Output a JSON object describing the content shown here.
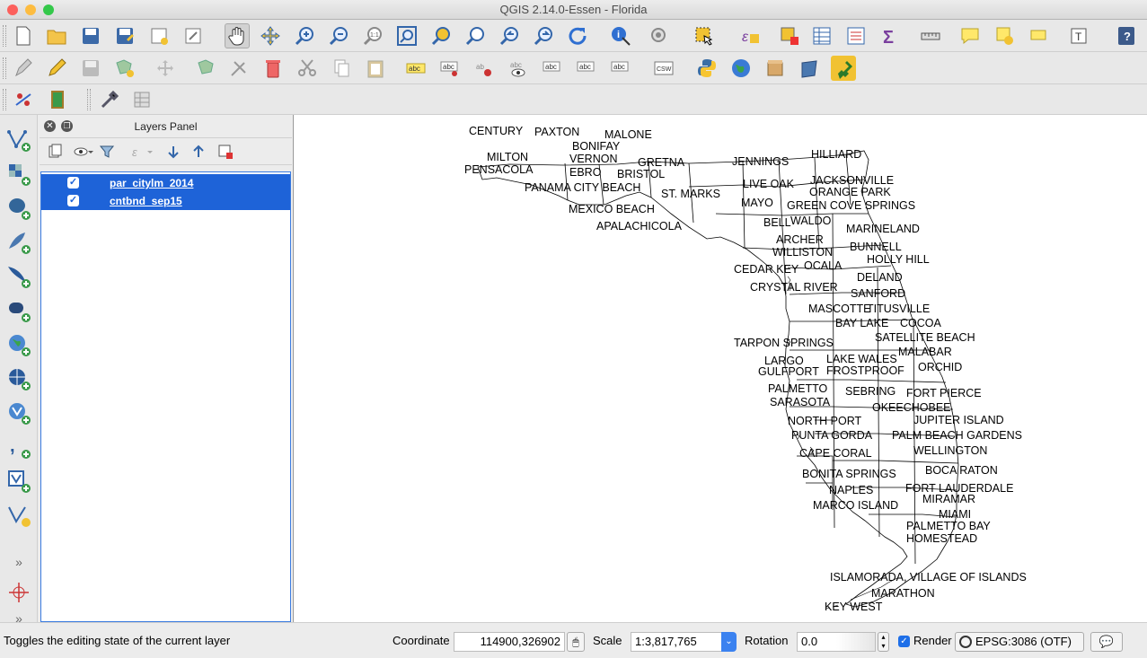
{
  "window": {
    "title": "QGIS 2.14.0-Essen - Florida"
  },
  "toolbar1": [
    "new-project-icon",
    "open-project-icon",
    "save-project-icon",
    "save-as-icon",
    "new-print-composer-icon",
    "composer-manager-icon",
    "pan-icon",
    "pan-to-selection-icon",
    "zoom-in-icon",
    "zoom-out-icon",
    "zoom-actual-icon",
    "zoom-full-icon",
    "zoom-to-selection-icon",
    "zoom-to-layer-icon",
    "zoom-last-icon",
    "zoom-next-icon",
    "refresh-icon",
    "identify-icon",
    "run-action-icon",
    "select-features-icon",
    "select-by-expression-icon",
    "deselect-icon",
    "attribute-table-icon",
    "field-calculator-icon",
    "statistical-summary-icon",
    "measure-icon",
    "map-tips-icon",
    "new-bookmark-icon",
    "show-bookmarks-icon",
    "text-annotation-icon",
    "help-icon"
  ],
  "toolbar2": [
    "current-edits-icon",
    "toggle-editing-icon",
    "save-edits-icon",
    "add-feature-icon",
    "move-feature-icon",
    "node-tool-icon",
    "delete-selected-icon",
    "cut-features-icon",
    "copy-features-icon",
    "paste-features-icon",
    "label-toolbar-icon",
    "pin-labels-icon",
    "highlight-pinned-icon",
    "show-hide-labels-icon",
    "move-label-icon",
    "rotate-label-icon",
    "change-label-icon",
    "csw-icon",
    "python-console-icon",
    "globe-icon",
    "db-manager-icon",
    "georeferencer-icon",
    "plugin-icon"
  ],
  "toolbar3": [
    "gps-icon",
    "layer-icon",
    "wrench-icon",
    "table-icon"
  ],
  "left_toolbar": [
    "add-vector-layer-icon",
    "add-raster-layer-icon",
    "add-postgis-layer-icon",
    "add-spatialite-layer-icon",
    "add-mssql-layer-icon",
    "add-oracle-layer-icon",
    "add-wms-layer-icon",
    "add-wcs-layer-icon",
    "add-wfs-layer-icon",
    "add-delimited-text-icon",
    "add-virtual-layer-icon",
    "new-shapefile-icon",
    "more-icon",
    "capture-point-icon",
    "more-bottom-icon"
  ],
  "layers_panel": {
    "title": "Layers Panel",
    "layers": [
      {
        "name": "par_citylm_2014",
        "checked": true
      },
      {
        "name": "cntbnd_sep15",
        "checked": true
      }
    ]
  },
  "map": {
    "labels": [
      {
        "text": "CENTURY"
      },
      {
        "text": "PAXTON"
      },
      {
        "text": "MALONE"
      },
      {
        "text": "BONIFAY"
      },
      {
        "text": "MILTON"
      },
      {
        "text": "VERNON"
      },
      {
        "text": "GRETNA"
      },
      {
        "text": "PENSACOLA"
      },
      {
        "text": "EBRO"
      },
      {
        "text": "BRISTOL"
      },
      {
        "text": "JENNINGS"
      },
      {
        "text": "HILLIARD"
      },
      {
        "text": "PANAMA CITY BEACH"
      },
      {
        "text": "ST. MARKS"
      },
      {
        "text": "LIVE OAK"
      },
      {
        "text": "JACKSONVILLE"
      },
      {
        "text": "ORANGE PARK"
      },
      {
        "text": "MAYO"
      },
      {
        "text": "GREEN COVE SPRINGS"
      },
      {
        "text": "MEXICO BEACH"
      },
      {
        "text": "APALACHICOLA"
      },
      {
        "text": "BELL"
      },
      {
        "text": "WALDO"
      },
      {
        "text": "MARINELAND"
      },
      {
        "text": "ARCHER"
      },
      {
        "text": "BUNNELL"
      },
      {
        "text": "WILLISTON"
      },
      {
        "text": "HOLLY HILL"
      },
      {
        "text": "CEDAR KEY"
      },
      {
        "text": "OCALA"
      },
      {
        "text": "DELAND"
      },
      {
        "text": "CRYSTAL RIVER"
      },
      {
        "text": "SANFORD"
      },
      {
        "text": "MASCOTTE"
      },
      {
        "text": "TITUSVILLE"
      },
      {
        "text": "BAY LAKE"
      },
      {
        "text": "COCOA"
      },
      {
        "text": "SATELLITE BEACH"
      },
      {
        "text": "TARPON SPRINGS"
      },
      {
        "text": "MALABAR"
      },
      {
        "text": "LARGO"
      },
      {
        "text": "LAKE WALES"
      },
      {
        "text": "ORCHID"
      },
      {
        "text": "GULFPORT"
      },
      {
        "text": "FROSTPROOF"
      },
      {
        "text": "PALMETTO"
      },
      {
        "text": "SEBRING"
      },
      {
        "text": "FORT PIERCE"
      },
      {
        "text": "SARASOTA"
      },
      {
        "text": "OKEECHOBEE"
      },
      {
        "text": "NORTH PORT"
      },
      {
        "text": "JUPITER ISLAND"
      },
      {
        "text": "PUNTA GORDA"
      },
      {
        "text": "PALM BEACH GARDENS"
      },
      {
        "text": "CAPE CORAL"
      },
      {
        "text": "WELLINGTON"
      },
      {
        "text": "BOCA RATON"
      },
      {
        "text": "BONITA SPRINGS"
      },
      {
        "text": "FORT LAUDERDALE"
      },
      {
        "text": "NAPLES"
      },
      {
        "text": "MIRAMAR"
      },
      {
        "text": "MARCO ISLAND"
      },
      {
        "text": "MIAMI"
      },
      {
        "text": "PALMETTO BAY"
      },
      {
        "text": "HOMESTEAD"
      },
      {
        "text": "ISLAMORADA, VILLAGE OF ISLANDS"
      },
      {
        "text": "MARATHON"
      },
      {
        "text": "KEY WEST"
      }
    ]
  },
  "status": {
    "message": "Toggles the editing state of the current layer",
    "coordinate_label": "Coordinate",
    "coordinate_value": "114900,326902",
    "scale_label": "Scale",
    "scale_value": "1:3,817,765",
    "rotation_label": "Rotation",
    "rotation_value": "0.0",
    "render_label": "Render",
    "render_checked": true,
    "crs": "EPSG:3086 (OTF)"
  },
  "colors": {
    "selection": "#1e63d8",
    "traffic_close": "#fc605c",
    "traffic_min": "#fdbc40",
    "traffic_max": "#34c84a"
  }
}
